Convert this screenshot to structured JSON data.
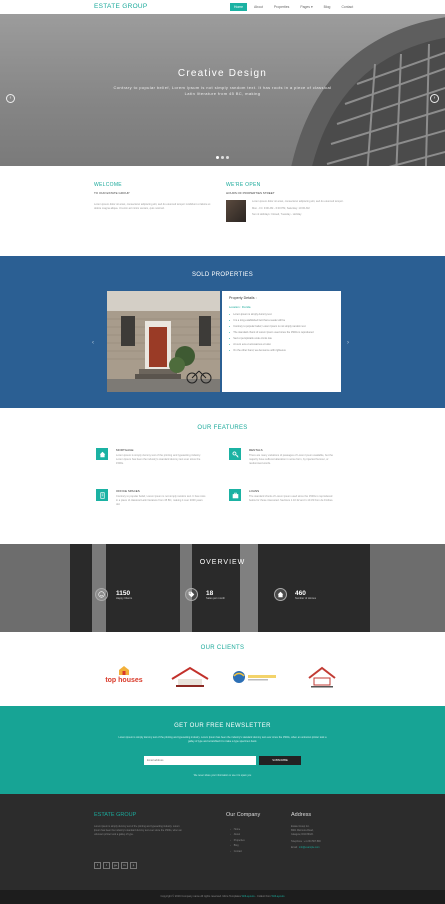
{
  "nav": {
    "brand": "ESTATE GROUP",
    "items": [
      "Home",
      "About",
      "Properties",
      "Pages ▾",
      "Blog",
      "Contact"
    ]
  },
  "hero": {
    "title": "Creative Design",
    "text": "Contrary to popular belief, Lorem Ipsum is not simply random text. It has roots in a piece of classical Latin literature from 45 BC, making"
  },
  "welcome": {
    "title": "WELCOME",
    "subtitle": "TO OUR ESTATE GROUP",
    "text": "Lorem ipsum dolor sit amet, consectetur adipiscing elit, sed do eiusmod tempor incididunt ut labore et dolore magna aliqua. Ut enim ad minim veniam, quis nostrud."
  },
  "open": {
    "title": "WE'RE OPEN",
    "subtitle": "HOURS OF PROPERTIES STREET",
    "text": "Lorem ipsum dolor sit amet, consectetur adipiscing elit, sed do eiusmod tempor.",
    "line1": "Mon - Fri: 9:00 AM - 6:00 PM, Saturday: 10:00 AM",
    "line2": "Sun & Holidays: Closed, Tuesday - Holiday"
  },
  "sold": {
    "title": "SOLD PROPERTIES",
    "details_title": "Property Details :",
    "location": "Location : Florida",
    "items": [
      "Lorem ipsum is simply dummy text",
      "It is a long established fact that a reader will be",
      "Contrary to popular belief, Lorem Ipsum is not simply random text",
      "The standard chunk of Lorem Ipsum used since the 1500s is reproduced",
      "Sed ut perspiciatis unde omnis iste",
      "At vero eos et accusamus et iusto",
      "On the other hand, we denounce with righteous"
    ]
  },
  "features": {
    "title": "OUR FEATURES",
    "items": [
      {
        "name": "MORTGAGE",
        "text": "Lorem ipsum is simply dummy text of the printing and typesetting industry. Lorem Ipsum has been the industry's standard dummy text ever since the 1500s."
      },
      {
        "name": "RENTALS",
        "text": "There are many variations of passages of Lorem Ipsum available, but the majority have suffered alteration in some form, by injected humour, or randomised words."
      },
      {
        "name": "OFFICE SPACES",
        "text": "Contrary to popular belief, Lorem Ipsum is not simply random text. It has roots in a piece of classical Latin literature from 45 BC, making it over 2000 years old."
      },
      {
        "name": "LOANS",
        "text": "The standard chunk of Lorem Ipsum used since the 1500s is reproduced below for those interested. Sections 1.10.32 and 1.10.33 from de Finibus."
      }
    ]
  },
  "overview": {
    "title": "OVERVIEW",
    "stats": [
      {
        "num": "1150",
        "label": "Happy Clients"
      },
      {
        "num": "18",
        "label": "Sales per month"
      },
      {
        "num": "460",
        "label": "Number of Homes"
      }
    ]
  },
  "clients": {
    "title": "OUR CLIENTS",
    "logo1": "top houses"
  },
  "newsletter": {
    "title": "GET OUR FREE NEWSLETTER",
    "text": "Lorem ipsum is simply dummy text of the printing and typesetting industry. Lorem Ipsum has been the industry's standard dummy text ever since the 1500s, when an unknown printer took a galley of type and scrambled it to make a type specimen book.",
    "placeholder": "Email address",
    "button": "SUBSCRIBE",
    "note": "We never share your information or use it to spam you"
  },
  "footer": {
    "brand": "ESTATE GROUP",
    "text": "Lorem ipsum is simply dummy text of the printing and typesetting industry. Lorem Ipsum has been the industry's standard dummy text ever since the 1500s, when an unknown printer took a galley of type.",
    "social": [
      "f",
      "t",
      "g+",
      "in",
      "p"
    ],
    "company_title": "Our Company",
    "links": [
      "Home",
      "About",
      "Properties",
      "Blog",
      "Contact"
    ],
    "address_title": "Address",
    "address_line1": "Estate Group Inc.",
    "address_line2": "8901 Marmora Road,",
    "address_line3": "Glasgow, D04 89GR.",
    "phone": "Telephone : +1 234 567 890",
    "email_label": "Email :",
    "email": "info@example.com"
  },
  "copyright": {
    "text": "Copyright © 2016 Company name All rights reserved. More Templates",
    "link1": "W3Layouts",
    "mid": "- Collect from",
    "link2": "W3Layouts"
  },
  "colors": {
    "teal": "#1aa99a",
    "blue": "#2b5f93",
    "dark": "#2c2c2c"
  }
}
